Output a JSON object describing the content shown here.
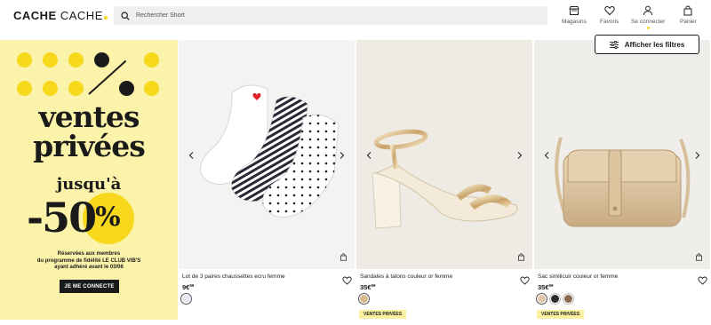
{
  "header": {
    "logo_part1": "CACHE",
    "logo_part2": "CACHE",
    "search": {
      "placeholder": "Rechercher Short"
    },
    "nav": [
      {
        "label": "Magasins",
        "icon": "store-icon"
      },
      {
        "label": "Favoris",
        "icon": "heart-icon"
      },
      {
        "label": "Se connecter",
        "icon": "user-icon"
      },
      {
        "label": "Panier",
        "icon": "bag-icon"
      }
    ]
  },
  "filters": {
    "label": "Afficher les filtres"
  },
  "promo": {
    "title_line1": "ventes",
    "title_line2": "privées",
    "subtitle": "jusqu'à",
    "discount": "-50",
    "percent": "%",
    "note_line1": "Réservées aux membres",
    "note_line2": "du programme de fidélité LE CLUB VIB'S",
    "note_line3": "ayant adhéré avant le 03/06",
    "cta": "JE ME CONNECTE",
    "colors": {
      "background": "#fbf3a9",
      "accent": "#f7d81d",
      "ink": "#1a1a1a"
    }
  },
  "products": [
    {
      "title": "Lot de 3 paires chaussettes ecru femme",
      "price_main": "9€",
      "price_cents": "99",
      "swatches": [
        "#e8e6f0"
      ],
      "badge": ""
    },
    {
      "title": "Sandales à talons couleur or femme",
      "price_main": "35€",
      "price_cents": "99",
      "swatches": [
        "#d9b88a"
      ],
      "badge": "VENTES PRIVÉES"
    },
    {
      "title": "Sac similicuir couleur or femme",
      "price_main": "35€",
      "price_cents": "99",
      "swatches": [
        "#e0c9a6",
        "#2b2b2b",
        "#8a6a4d"
      ],
      "badge": "VENTES PRIVÉES"
    }
  ]
}
